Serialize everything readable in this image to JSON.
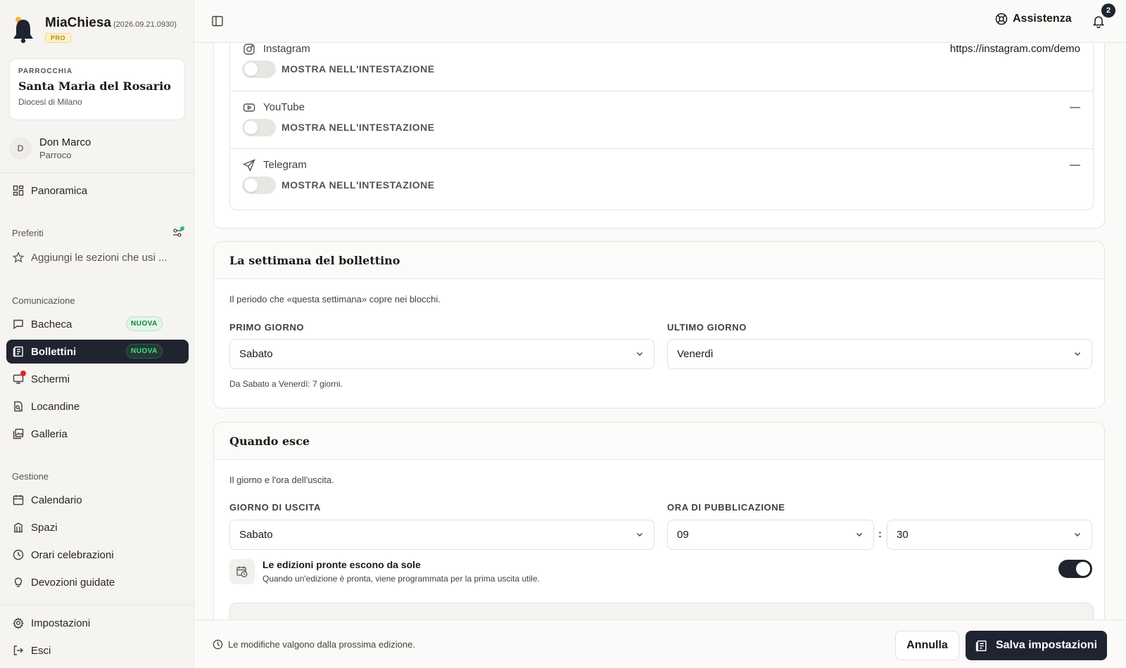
{
  "brand": {
    "name": "MiaChiesa",
    "version": "(2026.09.21.0930)",
    "badge": "PRO"
  },
  "parish": {
    "kicker": "PARROCCHIA",
    "name": "Santa Maria del Rosario",
    "diocese": "Diocesi di Milano"
  },
  "user": {
    "initial": "D",
    "name": "Don Marco",
    "role": "Parroco"
  },
  "nav": {
    "overview": "Panoramica",
    "favorites_label": "Preferiti",
    "favorites_add": "Aggiungi le sezioni che usi ...",
    "communication_label": "Comunicazione",
    "communication": [
      {
        "label": "Bacheca",
        "badge": "NUOVA"
      },
      {
        "label": "Bollettini",
        "badge": "NUOVA"
      },
      {
        "label": "Schermi"
      },
      {
        "label": "Locandine"
      },
      {
        "label": "Galleria"
      }
    ],
    "management_label": "Gestione",
    "management": [
      {
        "label": "Calendario"
      },
      {
        "label": "Spazi"
      },
      {
        "label": "Orari celebrazioni"
      },
      {
        "label": "Devozioni guidate"
      }
    ],
    "settings": "Impostazioni",
    "logout": "Esci"
  },
  "topbar": {
    "help": "Assistenza",
    "notifications_count": "2"
  },
  "social": {
    "toggle_label": "MOSTRA NELL'INTESTAZIONE",
    "items": [
      {
        "name": "Instagram",
        "value": "https://instagram.com/demo",
        "show_in_header": false,
        "icon": "instagram-icon"
      },
      {
        "name": "YouTube",
        "value": "—",
        "show_in_header": false,
        "icon": "youtube-icon"
      },
      {
        "name": "Telegram",
        "value": "—",
        "show_in_header": false,
        "icon": "telegram-icon"
      }
    ]
  },
  "week": {
    "title": "La settimana del bollettino",
    "description": "Il periodo che «questa settimana» copre nei blocchi.",
    "first_day_label": "PRIMO GIORNO",
    "first_day": "Sabato",
    "last_day_label": "ULTIMO GIORNO",
    "last_day": "Venerdì",
    "hint": "Da Sabato a Venerdì: 7 giorni."
  },
  "release": {
    "title": "Quando esce",
    "description": "Il giorno e l'ora dell'uscita.",
    "day_label": "GIORNO DI USCITA",
    "day": "Sabato",
    "time_label": "ORA DI PUBBLICAZIONE",
    "hour": "09",
    "separator": ":",
    "minute": "30",
    "auto_title": "Le edizioni pronte escono da sole",
    "auto_sub": "Quando un'edizione è pronta, viene programmata per la prima uscita utile.",
    "auto_enabled": true
  },
  "footer": {
    "note": "Le modifiche valgono dalla prossima edizione.",
    "cancel": "Annulla",
    "save": "Salva impostazioni"
  },
  "colors": {
    "accent": "#1f2430",
    "new_badge": "#15803d",
    "alert": "#dc2626",
    "online": "#22c55e",
    "pro": "#b88a1a"
  }
}
